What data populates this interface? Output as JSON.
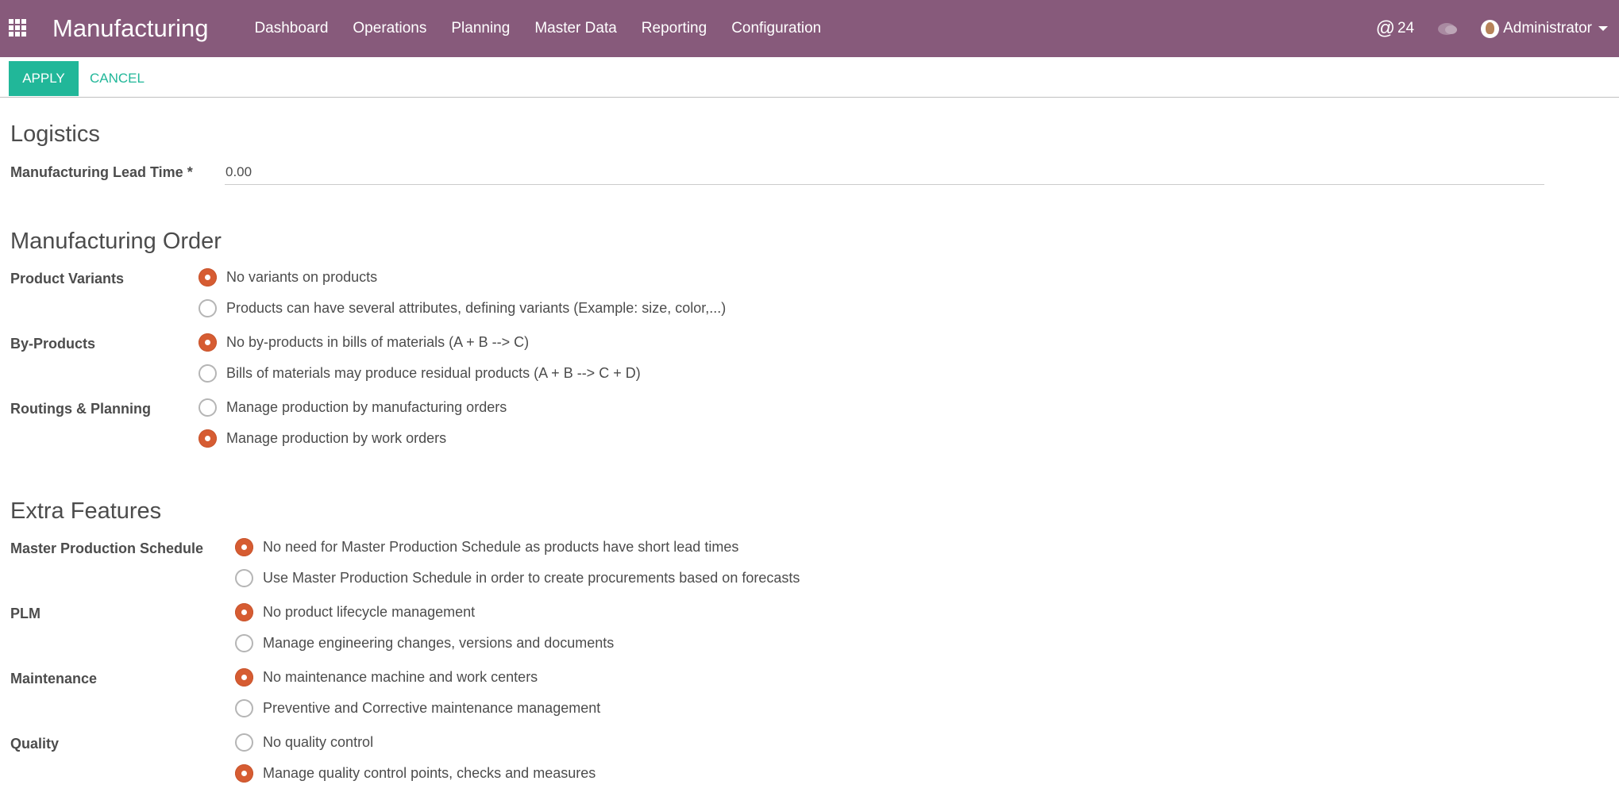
{
  "app": {
    "title": "Manufacturing",
    "menu": [
      "Dashboard",
      "Operations",
      "Planning",
      "Master Data",
      "Reporting",
      "Configuration"
    ]
  },
  "systray": {
    "notifications": "24",
    "at_symbol": "@",
    "user": "Administrator"
  },
  "actions": {
    "apply": "APPLY",
    "cancel": "CANCEL"
  },
  "logistics": {
    "title": "Logistics",
    "lead_time_label": "Manufacturing Lead Time *",
    "lead_time_value": "0.00"
  },
  "manufacturing_order": {
    "title": "Manufacturing Order",
    "product_variants": {
      "label": "Product Variants",
      "options": [
        {
          "label": "No variants on products",
          "checked": true
        },
        {
          "label": "Products can have several attributes, defining variants (Example: size, color,...)",
          "checked": false
        }
      ]
    },
    "by_products": {
      "label": "By-Products",
      "options": [
        {
          "label": "No by-products in bills of materials (A + B --> C)",
          "checked": true
        },
        {
          "label": "Bills of materials may produce residual products (A + B --> C + D)",
          "checked": false
        }
      ]
    },
    "routings": {
      "label": "Routings & Planning",
      "options": [
        {
          "label": "Manage production by manufacturing orders",
          "checked": false
        },
        {
          "label": "Manage production by work orders",
          "checked": true
        }
      ]
    }
  },
  "extra_features": {
    "title": "Extra Features",
    "mps": {
      "label": "Master Production Schedule",
      "options": [
        {
          "label": "No need for Master Production Schedule as products have short lead times",
          "checked": true
        },
        {
          "label": "Use Master Production Schedule in order to create procurements based on forecasts",
          "checked": false
        }
      ]
    },
    "plm": {
      "label": "PLM",
      "options": [
        {
          "label": "No product lifecycle management",
          "checked": true
        },
        {
          "label": "Manage engineering changes, versions and documents",
          "checked": false
        }
      ]
    },
    "maintenance": {
      "label": "Maintenance",
      "options": [
        {
          "label": "No maintenance machine and work centers",
          "checked": true
        },
        {
          "label": "Preventive and Corrective maintenance management",
          "checked": false
        }
      ]
    },
    "quality": {
      "label": "Quality",
      "options": [
        {
          "label": "No quality control",
          "checked": false
        },
        {
          "label": "Manage quality control points, checks and measures",
          "checked": true
        }
      ]
    }
  },
  "colors": {
    "navbar": "#875a7b",
    "primary": "#21b799",
    "radio_checked": "#d65c32"
  }
}
